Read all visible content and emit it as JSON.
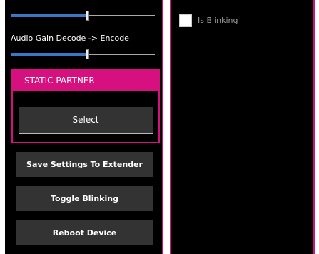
{
  "sliders": {
    "first_value": 0.53,
    "second_value": 0.53,
    "second_label": "Audio Gain Decode -> Encode"
  },
  "partner": {
    "header": "STATIC PARTNER",
    "select_label": "Select"
  },
  "buttons": {
    "save_label": "Save Settings To Extender",
    "toggle_label": "Toggle Blinking",
    "reboot_label": "Reboot Device"
  },
  "blinking": {
    "label": "Is Blinking",
    "checked": false
  },
  "colors": {
    "accent": "#d6117f",
    "slider_fill": "#3a78c5",
    "button_bg": "#333333",
    "background": "#000000"
  }
}
